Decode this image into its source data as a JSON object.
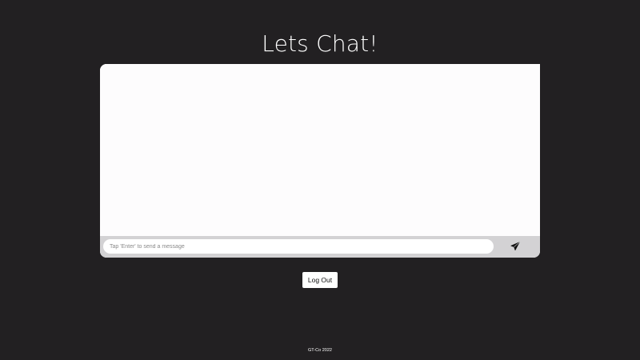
{
  "header": {
    "title": "Lets Chat!"
  },
  "chat": {
    "input_placeholder": "Tap 'Enter' to send a message",
    "input_value": "",
    "send_icon": "paper-plane-icon"
  },
  "actions": {
    "logout_label": "Log Out"
  },
  "footer": {
    "text": "GT-Co 2022"
  },
  "colors": {
    "background": "#222022",
    "chat_area": "#fdfcfd",
    "input_bar": "#d3d2d4"
  }
}
